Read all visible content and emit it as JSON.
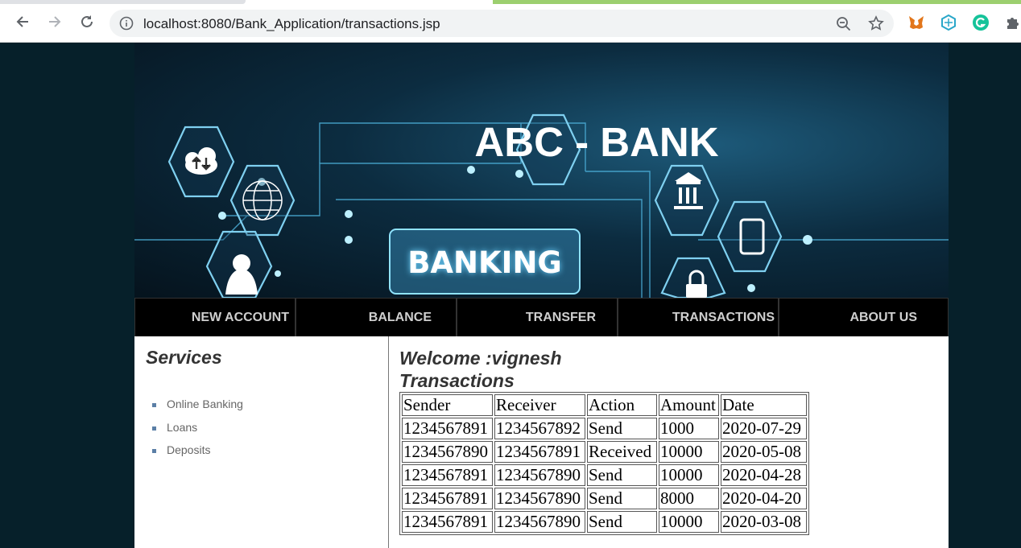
{
  "browser": {
    "url": "localhost:8080/Bank_Application/transactions.jsp"
  },
  "site": {
    "title": "ABC - BANK",
    "banner_text": "BANKING"
  },
  "nav": [
    {
      "label": "NEW ACCOUNT"
    },
    {
      "label": "BALANCE"
    },
    {
      "label": "TRANSFER"
    },
    {
      "label": "TRANSACTIONS"
    },
    {
      "label": "ABOUT US"
    }
  ],
  "sidebar": {
    "title": "Services",
    "items": [
      {
        "label": "Online Banking"
      },
      {
        "label": "Loans"
      },
      {
        "label": "Deposits"
      }
    ]
  },
  "main": {
    "welcome": "Welcome :vignesh",
    "heading": "Transactions",
    "table": {
      "headers": [
        "Sender",
        "Receiver",
        "Action",
        "Amount",
        "Date"
      ],
      "rows": [
        [
          "1234567891",
          "1234567892",
          "Send",
          "1000",
          "2020-07-29"
        ],
        [
          "1234567890",
          "1234567891",
          "Received",
          "10000",
          "2020-05-08"
        ],
        [
          "1234567891",
          "1234567890",
          "Send",
          "10000",
          "2020-04-28"
        ],
        [
          "1234567891",
          "1234567890",
          "Send",
          "8000",
          "2020-04-20"
        ],
        [
          "1234567891",
          "1234567890",
          "Send",
          "10000",
          "2020-03-08"
        ]
      ]
    }
  },
  "colors": {
    "page_background": "#06202a",
    "navbar": "#000000",
    "nav_text": "#cfcfcf"
  }
}
